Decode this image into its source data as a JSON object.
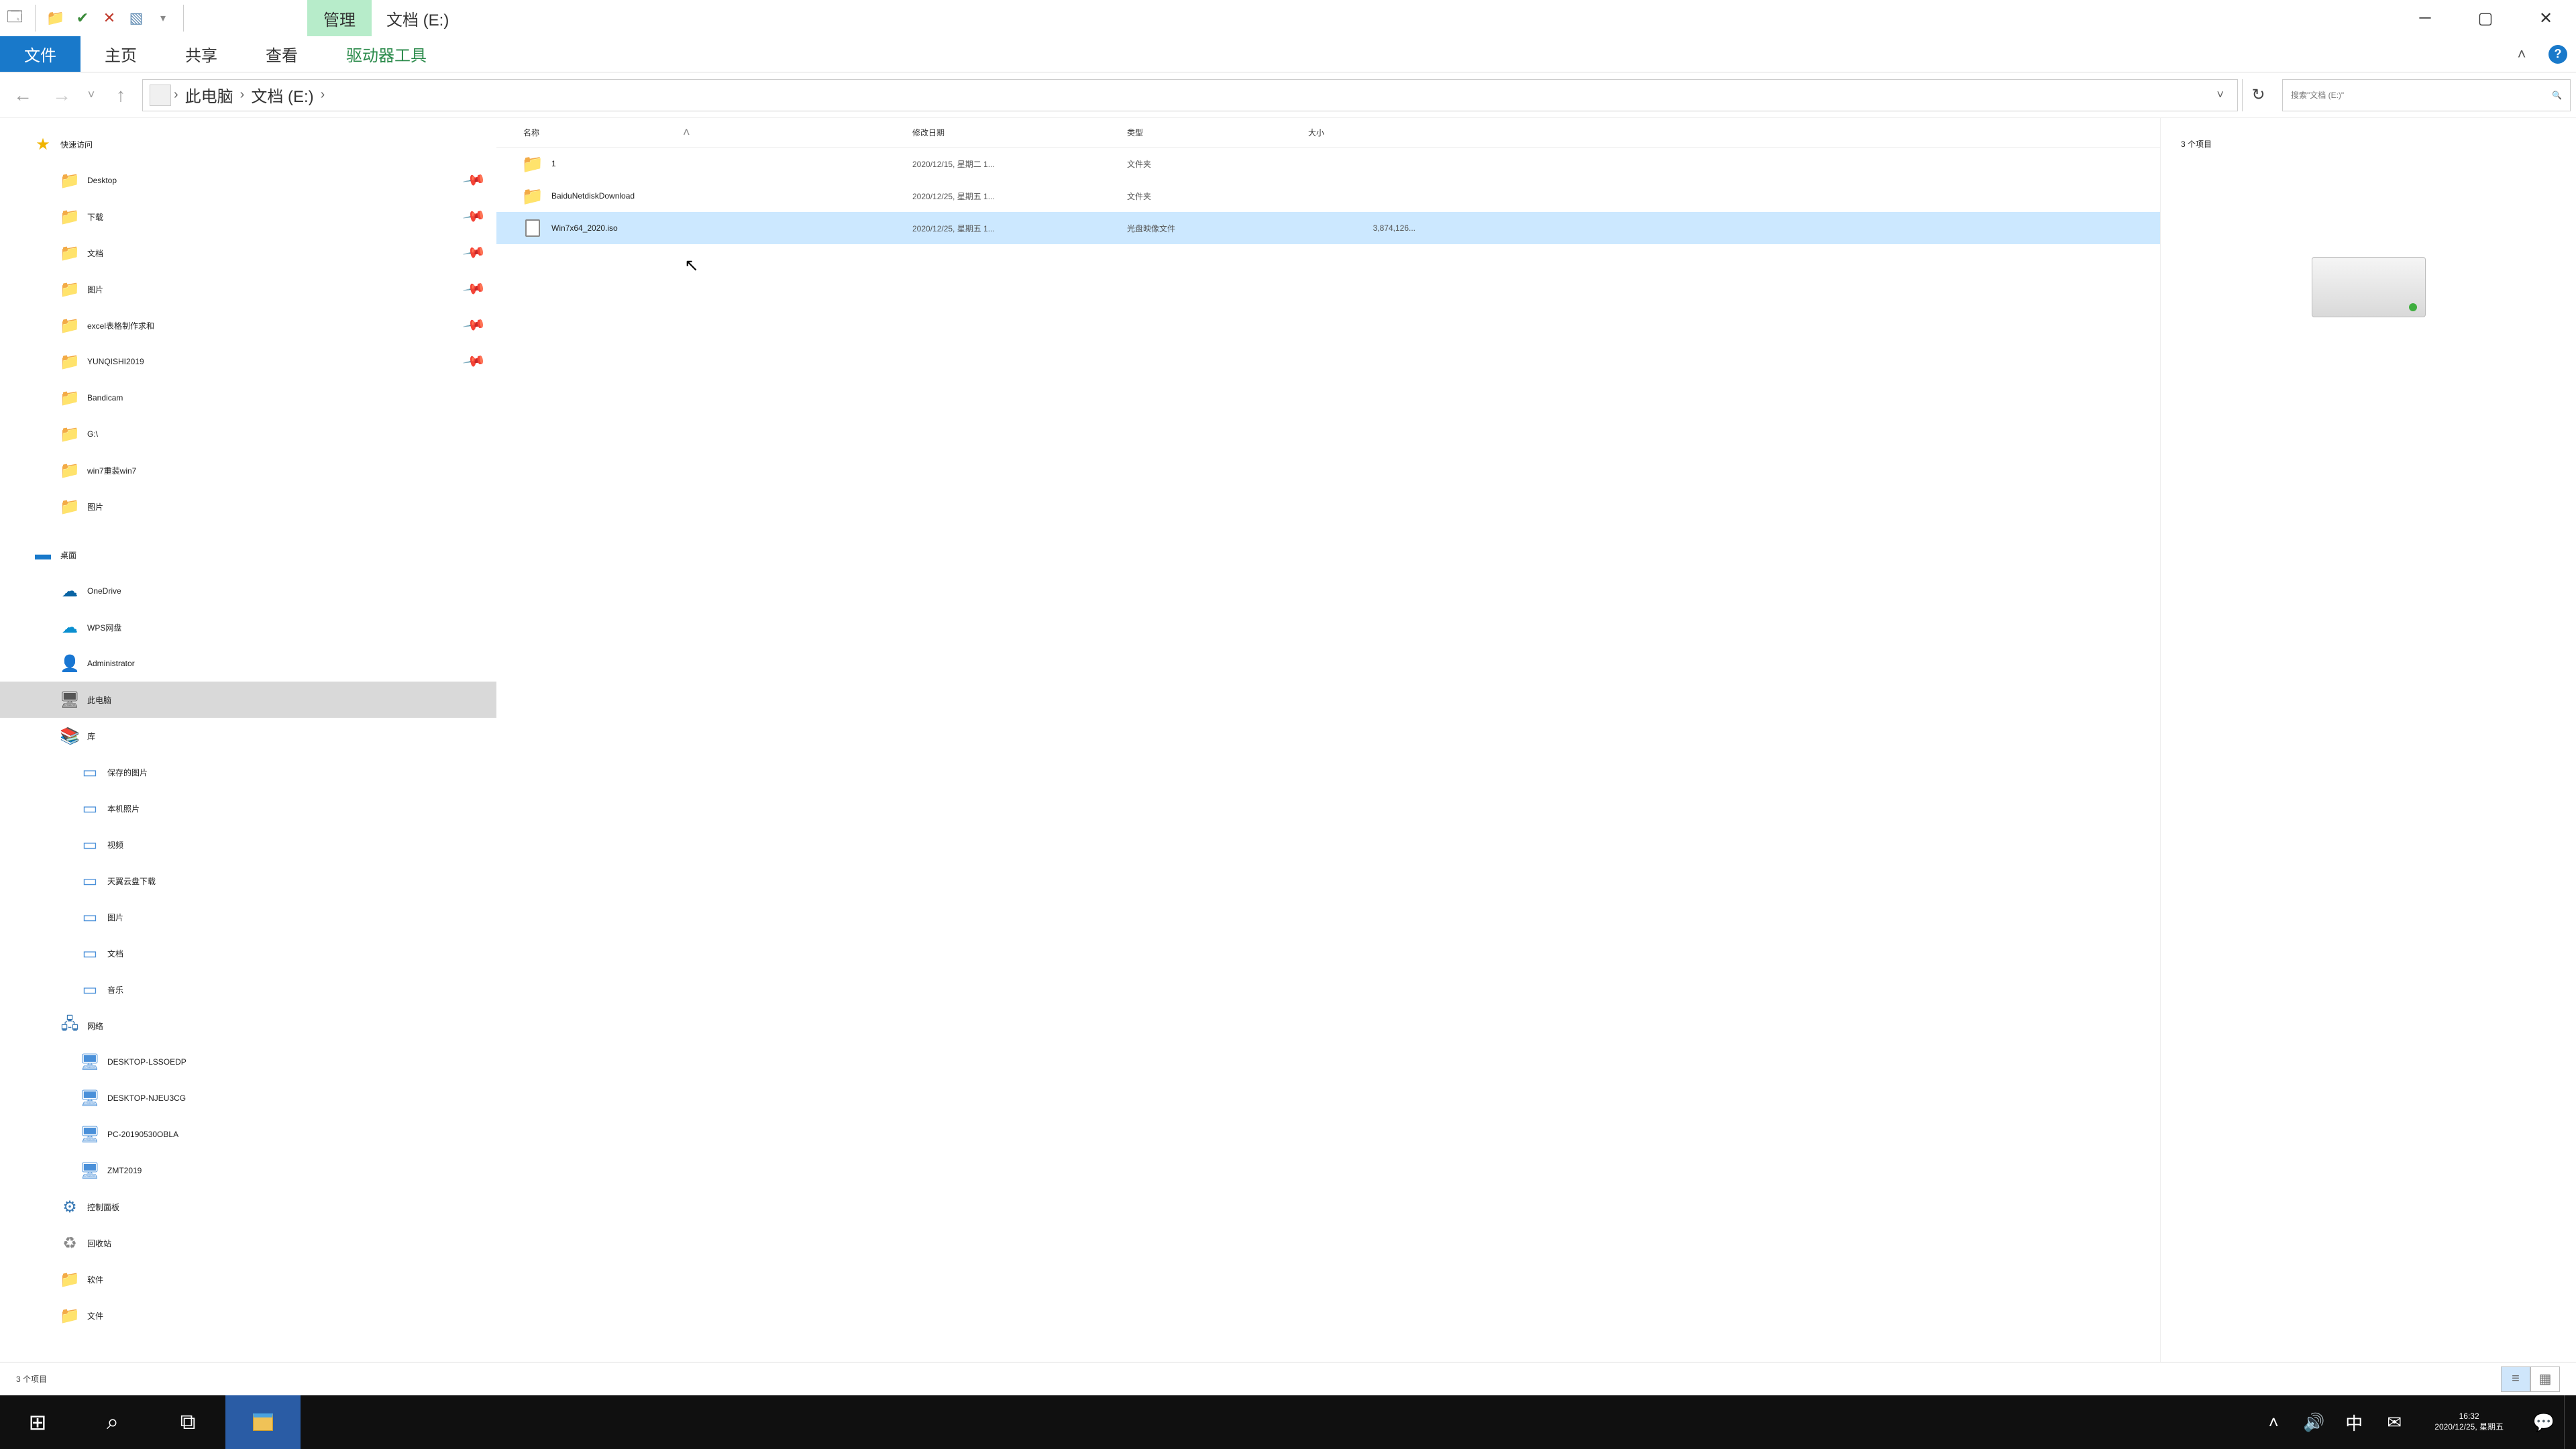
{
  "titlebar": {
    "context_tab": "管理",
    "window_title": "文档 (E:)",
    "qat_icons": [
      "app-icon",
      "folder-icon",
      "delete-icon",
      "properties-icon"
    ]
  },
  "ribbon": {
    "file": "文件",
    "home": "主页",
    "share": "共享",
    "view": "查看",
    "drive_tools": "驱动器工具"
  },
  "breadcrumb": {
    "root": "此电脑",
    "current": "文档 (E:)"
  },
  "search": {
    "placeholder": "搜索\"文档 (E:)\""
  },
  "nav": {
    "quick_access": "快速访问",
    "items_qa": [
      {
        "label": "Desktop",
        "icon": "desktop-icon",
        "pinned": true
      },
      {
        "label": "下载",
        "icon": "downloads-icon",
        "pinned": true
      },
      {
        "label": "文档",
        "icon": "documents-icon",
        "pinned": true
      },
      {
        "label": "图片",
        "icon": "pictures-icon",
        "pinned": true
      },
      {
        "label": "excel表格制作求和",
        "icon": "folder-icon",
        "pinned": true
      },
      {
        "label": "YUNQISHI2019",
        "icon": "folder-icon",
        "pinned": true
      },
      {
        "label": "Bandicam",
        "icon": "folder-icon",
        "pinned": false
      },
      {
        "label": "G:\\",
        "icon": "drive-icon",
        "pinned": false
      },
      {
        "label": "win7重装win7",
        "icon": "folder-icon",
        "pinned": false
      },
      {
        "label": "图片",
        "icon": "folder-icon",
        "pinned": false
      }
    ],
    "desktop": "桌面",
    "items_desktop": [
      {
        "label": "OneDrive",
        "icon": "onedrive-icon"
      },
      {
        "label": "WPS网盘",
        "icon": "wps-icon"
      },
      {
        "label": "Administrator",
        "icon": "user-icon"
      },
      {
        "label": "此电脑",
        "icon": "pc-icon",
        "selected": true
      },
      {
        "label": "库",
        "icon": "library-icon"
      }
    ],
    "items_lib": [
      {
        "label": "保存的图片",
        "icon": "picsave-icon"
      },
      {
        "label": "本机照片",
        "icon": "camera-icon"
      },
      {
        "label": "视频",
        "icon": "video-icon"
      },
      {
        "label": "天翼云盘下载",
        "icon": "cloud-icon"
      },
      {
        "label": "图片",
        "icon": "pictures-icon"
      },
      {
        "label": "文档",
        "icon": "documents-icon"
      },
      {
        "label": "音乐",
        "icon": "music-icon"
      }
    ],
    "network": "网络",
    "items_net": [
      {
        "label": "DESKTOP-LSSOEDP",
        "icon": "pc-net-icon"
      },
      {
        "label": "DESKTOP-NJEU3CG",
        "icon": "pc-net-icon"
      },
      {
        "label": "PC-20190530OBLA",
        "icon": "pc-net-icon"
      },
      {
        "label": "ZMT2019",
        "icon": "pc-net-icon"
      }
    ],
    "control_panel": "控制面板",
    "recycle": "回收站",
    "software": "软件",
    "docs": "文件"
  },
  "columns": {
    "name": "名称",
    "modified": "修改日期",
    "type": "类型",
    "size": "大小"
  },
  "files": [
    {
      "name": "1",
      "date": "2020/12/15, 星期二 1...",
      "type": "文件夹",
      "size": "",
      "icon": "folder"
    },
    {
      "name": "BaiduNetdiskDownload",
      "date": "2020/12/25, 星期五 1...",
      "type": "文件夹",
      "size": "",
      "icon": "folder"
    },
    {
      "name": "Win7x64_2020.iso",
      "date": "2020/12/25, 星期五 1...",
      "type": "光盘映像文件",
      "size": "3,874,126...",
      "icon": "iso",
      "selected": true
    }
  ],
  "preview": {
    "count_label": "3 个项目"
  },
  "statusbar": {
    "text": "3 个项目"
  },
  "taskbar": {
    "clock_time": "16:32",
    "clock_date": "2020/12/25, 星期五",
    "ime": "中"
  },
  "colors": {
    "accent": "#1979ca",
    "context_tab": "#b7ecca",
    "selection": "#cce8ff"
  }
}
